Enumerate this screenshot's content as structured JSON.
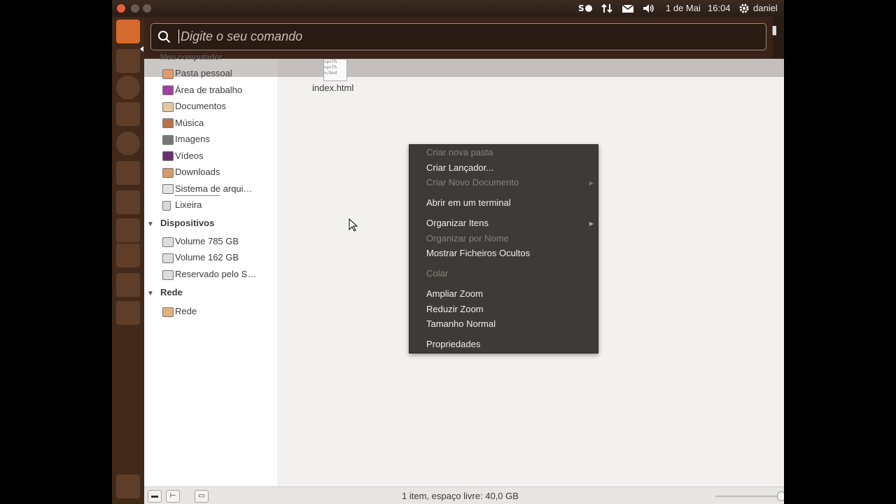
{
  "top_panel": {
    "date": "1 de Mai",
    "time": "16:04",
    "user": "daniel",
    "indicators": [
      "skype-icon",
      "network-updown-icon",
      "mail-icon",
      "volume-icon",
      "power-gear-icon"
    ]
  },
  "search": {
    "placeholder": "Digite o seu comando"
  },
  "sidebar": {
    "partial_heading": "Meu computador",
    "places": [
      {
        "label": "Pasta pessoal",
        "icon": "home-folder-icon"
      },
      {
        "label": "Área de trabalho",
        "icon": "desktop-icon"
      },
      {
        "label": "Documentos",
        "icon": "documents-folder-icon"
      },
      {
        "label": "Música",
        "icon": "music-folder-icon"
      },
      {
        "label": "Imagens",
        "icon": "pictures-folder-icon"
      },
      {
        "label": "Vídeos",
        "icon": "videos-folder-icon"
      },
      {
        "label": "Downloads",
        "icon": "downloads-folder-icon"
      },
      {
        "label": "Sistema de arqui…",
        "icon": "filesystem-icon"
      },
      {
        "label": "Lixeira",
        "icon": "trash-icon"
      }
    ],
    "devices_heading": "Dispositivos",
    "devices": [
      {
        "label": "Volume 785 GB",
        "icon": "drive-icon"
      },
      {
        "label": "Volume 162 GB",
        "icon": "drive-icon"
      },
      {
        "label": "Reservado pelo S…",
        "icon": "drive-icon"
      }
    ],
    "network_heading": "Rede",
    "network": [
      {
        "label": "Rede",
        "icon": "network-icon"
      }
    ]
  },
  "files": [
    {
      "name": "index.html",
      "preview": "<p>Th\n<p>Th\n</bod"
    }
  ],
  "context_menu": {
    "items": [
      {
        "label": "Criar nova pasta",
        "enabled": false
      },
      {
        "label": "Criar Lançador...",
        "enabled": true
      },
      {
        "label": "Criar Novo Documento",
        "enabled": false,
        "submenu": true
      },
      {
        "label": "Abrir em um terminal",
        "enabled": true
      },
      {
        "label": "Organizar Itens",
        "enabled": true,
        "submenu": true
      },
      {
        "label": "Organizar por Nome",
        "enabled": false
      },
      {
        "label": "Mostrar Ficheiros Ocultos",
        "enabled": true
      },
      {
        "label": "Colar",
        "enabled": false
      },
      {
        "label": "Ampliar Zoom",
        "enabled": true
      },
      {
        "label": "Reduzir Zoom",
        "enabled": true
      },
      {
        "label": "Tamanho Normal",
        "enabled": true
      },
      {
        "label": "Propriedades",
        "enabled": true
      }
    ]
  },
  "statusbar": {
    "text": "1 item, espaço livre: 40,0 GB"
  },
  "colors": {
    "accent": "#d56a2c",
    "menu_bg": "#3c3b37",
    "panel_bg": "#2b1e17"
  }
}
